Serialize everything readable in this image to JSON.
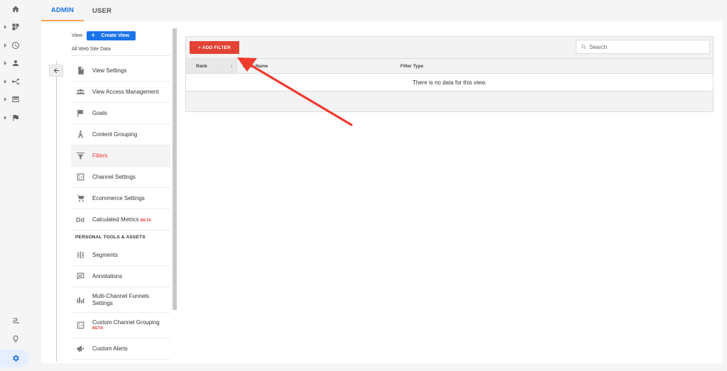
{
  "rail": {
    "top_items": [
      {
        "name": "home",
        "icon": "home-icon",
        "expandable": false
      },
      {
        "name": "customization",
        "icon": "dashboard-icon",
        "expandable": true
      },
      {
        "name": "realtime",
        "icon": "clock-icon",
        "expandable": true
      },
      {
        "name": "audience",
        "icon": "person-icon",
        "expandable": true
      },
      {
        "name": "acquisition",
        "icon": "acquisition-icon",
        "expandable": true
      },
      {
        "name": "behavior",
        "icon": "behavior-icon",
        "expandable": true
      },
      {
        "name": "conversions",
        "icon": "flag-icon",
        "expandable": true
      }
    ],
    "bottom_items": [
      {
        "name": "attribution",
        "icon": "attribution-icon"
      },
      {
        "name": "discover",
        "icon": "lightbulb-icon"
      },
      {
        "name": "admin",
        "icon": "gear-icon",
        "active": true
      }
    ],
    "accent": "#1a73e8"
  },
  "tabs": [
    {
      "label": "ADMIN",
      "active": true
    },
    {
      "label": "USER",
      "active": false
    }
  ],
  "view": {
    "label": "View",
    "create_button": "Create View",
    "current_view": "All Web Site Data"
  },
  "sidebar": {
    "items": [
      {
        "label": "View Settings",
        "icon": "document-icon"
      },
      {
        "label": "View Access Management",
        "icon": "people-icon"
      },
      {
        "label": "Goals",
        "icon": "flag-icon"
      },
      {
        "label": "Content Grouping",
        "icon": "content-grouping-icon"
      },
      {
        "label": "Filters",
        "icon": "filter-icon",
        "active": true
      },
      {
        "label": "Channel Settings",
        "icon": "channel-settings-icon"
      },
      {
        "label": "Ecommerce Settings",
        "icon": "cart-icon"
      },
      {
        "label": "Calculated Metrics",
        "icon": "calculated-metrics-icon",
        "badge": "BETA"
      }
    ],
    "section_header": "PERSONAL TOOLS & ASSETS",
    "personal_items": [
      {
        "label": "Segments",
        "icon": "segments-icon"
      },
      {
        "label": "Annotations",
        "icon": "annotations-icon"
      },
      {
        "label": "Multi-Channel Funnels Settings",
        "icon": "bar-chart-icon"
      },
      {
        "label": "Custom Channel Grouping",
        "icon": "channel-grouping-icon",
        "badge": "BETA"
      },
      {
        "label": "Custom Alerts",
        "icon": "megaphone-icon"
      }
    ]
  },
  "filters_table": {
    "add_button": "+ ADD FILTER",
    "search_placeholder": "Search",
    "columns": [
      "Rank",
      "Filter Name",
      "Filter Type"
    ],
    "sort_indicator": "↓",
    "empty_message": "There is no data for this view.",
    "rows": []
  },
  "colors": {
    "primary_blue": "#1a73e8",
    "add_filter_red": "#e34234",
    "active_red": "#e53935",
    "tab_underline": "#f6a44c",
    "annotation_arrow": "#f03a2e"
  }
}
